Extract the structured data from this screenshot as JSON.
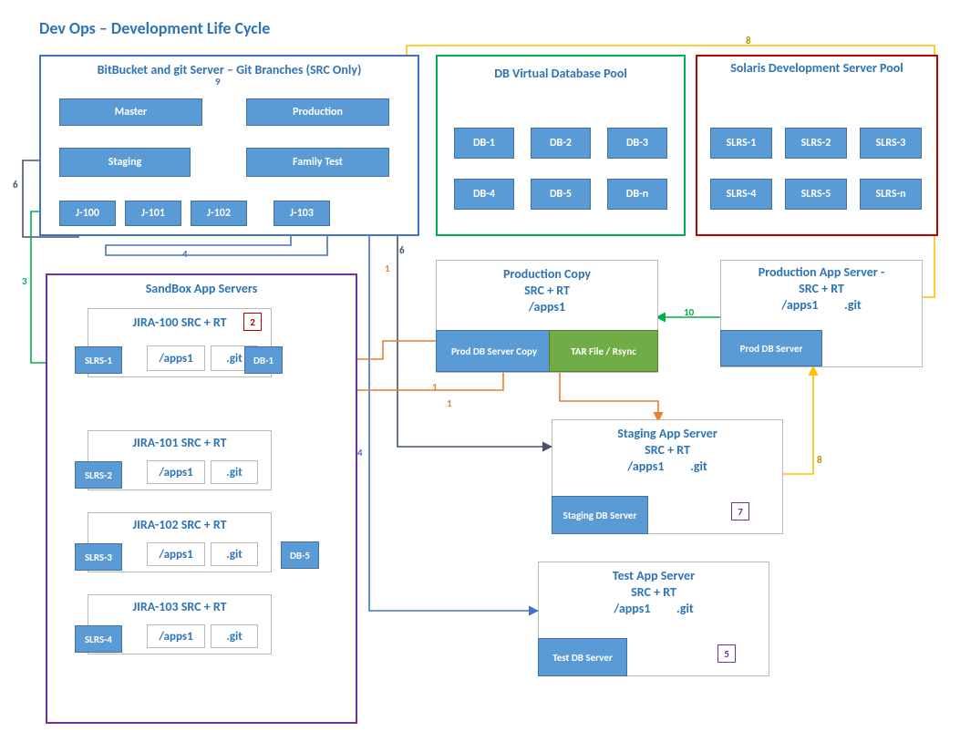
{
  "title": "Dev Ops – Development Life Cycle",
  "pools": {
    "git": {
      "title": "BitBucket and git Server – Git Branches (SRC Only)"
    },
    "dbpool": {
      "title": "DB Virtual Database Pool"
    },
    "solaris": {
      "title": "Solaris Development Server Pool"
    },
    "sandbox": {
      "title": "SandBox App Servers"
    }
  },
  "git_branches": {
    "master": "Master",
    "production": "Production",
    "staging": "Staging",
    "familytest": "Family Test",
    "j100": "J-100",
    "j101": "J-101",
    "j102": "J-102",
    "j103": "J-103"
  },
  "db_pool": {
    "db1": "DB-1",
    "db2": "DB-2",
    "db3": "DB-3",
    "db4": "DB-4",
    "db5": "DB-5",
    "dbn": "DB-n"
  },
  "slrs_pool": {
    "s1": "SLRS-1",
    "s2": "SLRS-2",
    "s3": "SLRS-3",
    "s4": "SLRS-4",
    "s5": "SLRS-5",
    "sn": "SLRS-n"
  },
  "sandbox": {
    "j100": {
      "title": "JIRA-100 SRC + RT",
      "slrs": "SLRS-1",
      "apps": "/apps1",
      "git": ".git",
      "db": "DB-1",
      "badge": "2"
    },
    "j101": {
      "title": "JIRA-101 SRC + RT",
      "slrs": "SLRS-2",
      "apps": "/apps1",
      "git": ".git"
    },
    "j102": {
      "title": "JIRA-102 SRC + RT",
      "slrs": "SLRS-3",
      "apps": "/apps1",
      "git": ".git",
      "db": "DB-5"
    },
    "j103": {
      "title": "JIRA-103 SRC + RT",
      "slrs": "SLRS-4",
      "apps": "/apps1",
      "git": ".git"
    }
  },
  "prodcopy": {
    "title_l1": "Production Copy",
    "title_l2": "SRC + RT",
    "title_l3": "/apps1",
    "db": "Prod DB Server Copy",
    "tar": "TAR File / Rsync"
  },
  "prodapp": {
    "title_l1": "Production App Server -",
    "title_l2": "SRC + RT",
    "apps": "/apps1",
    "git": ".git",
    "db": "Prod DB Server"
  },
  "staging": {
    "title_l1": "Staging App Server",
    "title_l2": "SRC + RT",
    "apps": "/apps1",
    "git": ".git",
    "db": "Staging DB Server",
    "badge": "7"
  },
  "test": {
    "title_l1": "Test App Server",
    "title_l2": "SRC + RT",
    "apps": "/apps1",
    "git": ".git",
    "db": "Test DB Server",
    "badge": "5"
  },
  "edges": {
    "e1": "1",
    "e1b": "1",
    "e1c": "1",
    "e2": "2",
    "e3": "3",
    "e4": "4",
    "e4b": "4",
    "e5": "5",
    "e6": "6",
    "e6b": "6",
    "e7": "7",
    "e8": "8",
    "e8b": "8",
    "e9": "9",
    "e10": "10"
  },
  "colors": {
    "blue": "#4472C4",
    "orange": "#ED7D31",
    "green": "#00B050",
    "gold": "#FFC000",
    "steel": "#44546A",
    "purple": "#7030A0",
    "red": "#C00000",
    "gray": "#B9B9B9"
  }
}
